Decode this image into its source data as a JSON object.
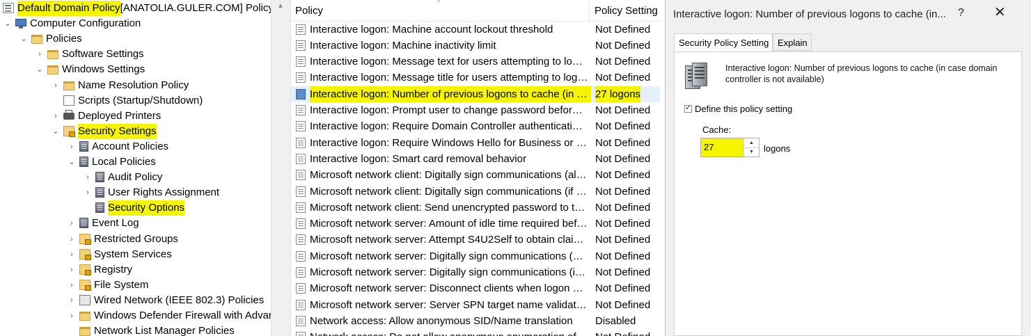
{
  "tree": {
    "items": [
      {
        "label": "Default Domain Policy",
        "suffix": " [ANATOLIA.GULER.COM] Policy",
        "chev": "",
        "icon": "policy",
        "indent": 0,
        "highlight": true
      },
      {
        "label": "Computer Configuration",
        "chev": "⌄",
        "icon": "computer",
        "indent": 0,
        "highlight": false
      },
      {
        "label": "Policies",
        "chev": "⌄",
        "icon": "folder",
        "indent": 1,
        "highlight": false
      },
      {
        "label": "Software Settings",
        "chev": "›",
        "icon": "folder",
        "indent": 2,
        "highlight": false
      },
      {
        "label": "Windows Settings",
        "chev": "⌄",
        "icon": "folder",
        "indent": 2,
        "highlight": false
      },
      {
        "label": "Name Resolution Policy",
        "chev": "›",
        "icon": "folder",
        "indent": 3,
        "highlight": false
      },
      {
        "label": "Scripts (Startup/Shutdown)",
        "chev": "",
        "icon": "doc",
        "indent": 3,
        "highlight": false
      },
      {
        "label": "Deployed Printers",
        "chev": "›",
        "icon": "printer",
        "indent": 3,
        "highlight": false
      },
      {
        "label": "Security Settings",
        "chev": "⌄",
        "icon": "lockfolder",
        "indent": 3,
        "highlight": true
      },
      {
        "label": "Account Policies",
        "chev": "›",
        "icon": "server",
        "indent": 4,
        "highlight": false
      },
      {
        "label": "Local Policies",
        "chev": "⌄",
        "icon": "server",
        "indent": 4,
        "highlight": false
      },
      {
        "label": "Audit Policy",
        "chev": "›",
        "icon": "server",
        "indent": 5,
        "highlight": false
      },
      {
        "label": "User Rights Assignment",
        "chev": "›",
        "icon": "server",
        "indent": 5,
        "highlight": false
      },
      {
        "label": "Security Options",
        "chev": "",
        "icon": "server",
        "indent": 5,
        "highlight": true
      },
      {
        "label": "Event Log",
        "chev": "›",
        "icon": "server",
        "indent": 4,
        "highlight": false
      },
      {
        "label": "Restricted Groups",
        "chev": "›",
        "icon": "lockfolder",
        "indent": 4,
        "highlight": false
      },
      {
        "label": "System Services",
        "chev": "›",
        "icon": "lockfolder",
        "indent": 4,
        "highlight": false
      },
      {
        "label": "Registry",
        "chev": "›",
        "icon": "lockfolder",
        "indent": 4,
        "highlight": false
      },
      {
        "label": "File System",
        "chev": "›",
        "icon": "lockfolder",
        "indent": 4,
        "highlight": false
      },
      {
        "label": "Wired Network (IEEE 802.3) Policies",
        "chev": "›",
        "icon": "network",
        "indent": 4,
        "highlight": false
      },
      {
        "label": "Windows Defender Firewall with Advar",
        "chev": "›",
        "icon": "folder",
        "indent": 4,
        "highlight": false
      },
      {
        "label": "Network List Manager Policies",
        "chev": "",
        "icon": "folder",
        "indent": 4,
        "highlight": false
      }
    ]
  },
  "list": {
    "col_policy": "Policy",
    "col_setting": "Policy Setting",
    "sort_caret": "^",
    "rows": [
      {
        "policy": "Interactive logon: Machine account lockout threshold",
        "setting": "Not Defined"
      },
      {
        "policy": "Interactive logon: Machine inactivity limit",
        "setting": "Not Defined"
      },
      {
        "policy": "Interactive logon: Message text for users attempting to log on",
        "setting": "Not Defined"
      },
      {
        "policy": "Interactive logon: Message title for users attempting to log on",
        "setting": "Not Defined"
      },
      {
        "policy": "Interactive logon: Number of previous logons to cache (in cas...",
        "setting": "27 logons",
        "highlight": true
      },
      {
        "policy": "Interactive logon: Prompt user to change password before ex...",
        "setting": "Not Defined"
      },
      {
        "policy": "Interactive logon: Require Domain Controller authentication t...",
        "setting": "Not Defined"
      },
      {
        "policy": "Interactive logon: Require Windows Hello for Business or sma...",
        "setting": "Not Defined"
      },
      {
        "policy": "Interactive logon: Smart card removal behavior",
        "setting": "Not Defined"
      },
      {
        "policy": "Microsoft network client: Digitally sign communications (alwa...",
        "setting": "Not Defined"
      },
      {
        "policy": "Microsoft network client: Digitally sign communications (if se...",
        "setting": "Not Defined"
      },
      {
        "policy": "Microsoft network client: Send unencrypted password to thir...",
        "setting": "Not Defined"
      },
      {
        "policy": "Microsoft network server: Amount of idle time required befor...",
        "setting": "Not Defined"
      },
      {
        "policy": "Microsoft network server: Attempt S4U2Self to obtain claim in...",
        "setting": "Not Defined"
      },
      {
        "policy": "Microsoft network server: Digitally sign communications (alw...",
        "setting": "Not Defined"
      },
      {
        "policy": "Microsoft network server: Digitally sign communications (if cli...",
        "setting": "Not Defined"
      },
      {
        "policy": "Microsoft network server: Disconnect clients when logon hou...",
        "setting": "Not Defined"
      },
      {
        "policy": "Microsoft network server: Server SPN target name validation l...",
        "setting": "Not Defined"
      },
      {
        "policy": "Network access: Allow anonymous SID/Name translation",
        "setting": "Disabled"
      },
      {
        "policy": "Network access: Do not allow anonymous enumeration of SA...",
        "setting": "Not Defined"
      }
    ]
  },
  "dialog": {
    "title": "Interactive logon: Number of previous logons to cache (in...",
    "help": "?",
    "close": "✕",
    "tabs": [
      {
        "label": "Security Policy Setting"
      },
      {
        "label": "Explain"
      }
    ],
    "description": "Interactive logon: Number of previous logons to cache (in case domain controller is not available)",
    "define_label": "Define this policy setting",
    "define_checked": true,
    "cache_label": "Cache:",
    "cache_value": "27",
    "spin_up": "▲",
    "spin_down": "▼",
    "unit_label": "logons"
  },
  "colors": {
    "highlight": "#f5f500",
    "accent": "#4f8fdc"
  }
}
